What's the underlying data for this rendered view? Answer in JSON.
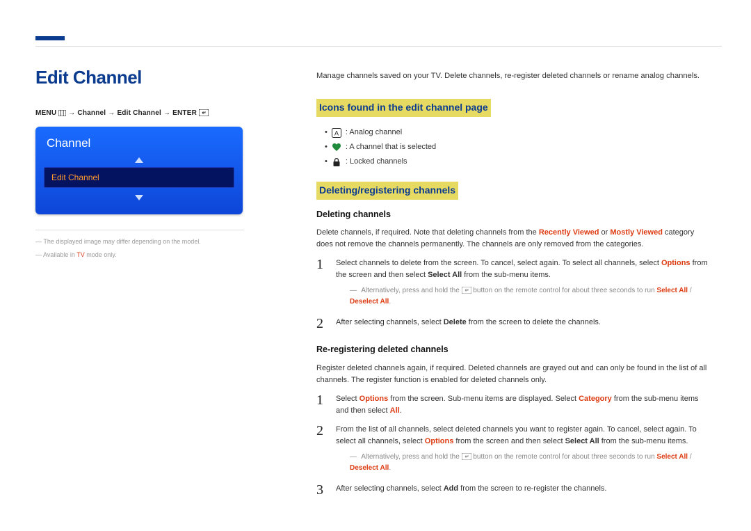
{
  "page": {
    "title": "Edit Channel",
    "intro": "Manage channels saved on your TV. Delete channels, re-register deleted channels or rename analog channels."
  },
  "path": {
    "menu": "MENU",
    "p1": "Channel",
    "p2": "Edit Channel",
    "enter": "ENTER"
  },
  "tv": {
    "header": "Channel",
    "item": "Edit Channel"
  },
  "footnotes": {
    "f1": "The displayed image may differ depending on the model.",
    "f2_a": "Available in ",
    "f2_b": "TV",
    "f2_c": " mode only."
  },
  "icons": {
    "heading": "Icons found in the edit channel page",
    "a_label": "A",
    "a_text": ": Analog channel",
    "heart_text": ": A channel that is selected",
    "lock_text": ": Locked channels"
  },
  "deleting": {
    "heading": "Deleting/registering channels",
    "sub1": "Deleting channels",
    "p1_a": "Delete channels, if required. Note that deleting channels from the ",
    "p1_b": "Recently Viewed",
    "p1_c": " or ",
    "p1_d": "Mostly Viewed",
    "p1_e": " category does not remove the channels permanently. The channels are only removed from the categories.",
    "s1_a": "Select channels to delete from the screen. To cancel, select again. To select all channels, select ",
    "s1_b": "Options",
    "s1_c": " from the screen and then select ",
    "s1_d": "Select All",
    "s1_e": " from the sub-menu items.",
    "tip1_a": "Alternatively, press and hold the ",
    "tip1_b": " button on the remote control for about three seconds to run ",
    "tip1_c": "Select All",
    "tip1_d": " / ",
    "tip1_e": "Deselect All",
    "tip1_f": ".",
    "s2_a": "After selecting channels, select ",
    "s2_b": "Delete",
    "s2_c": " from the screen to delete the channels.",
    "sub2": "Re-registering deleted channels",
    "p2": "Register deleted channels again, if required. Deleted channels are grayed out and can only be found in the list of all channels. The register function is enabled for deleted channels only.",
    "r1_a": "Select ",
    "r1_b": "Options",
    "r1_c": " from the screen. Sub-menu items are displayed. Select ",
    "r1_d": "Category",
    "r1_e": " from the sub-menu items and then select ",
    "r1_f": "All",
    "r1_g": ".",
    "r2_a": "From the list of all channels, select deleted channels you want to register again. To cancel, select again. To select all channels, select ",
    "r2_b": "Options",
    "r2_c": " from the screen and then select ",
    "r2_d": "Select All",
    "r2_e": " from the sub-menu items.",
    "tip2_a": "Alternatively, press and hold the ",
    "tip2_b": " button on the remote control for about three seconds to run ",
    "tip2_c": "Select All",
    "tip2_d": " / ",
    "tip2_e": "Deselect All",
    "tip2_f": ".",
    "r3_a": "After selecting channels, select ",
    "r3_b": "Add",
    "r3_c": " from the screen to re-register the channels."
  },
  "numbers": {
    "n1": "1",
    "n2": "2",
    "n3": "3"
  }
}
